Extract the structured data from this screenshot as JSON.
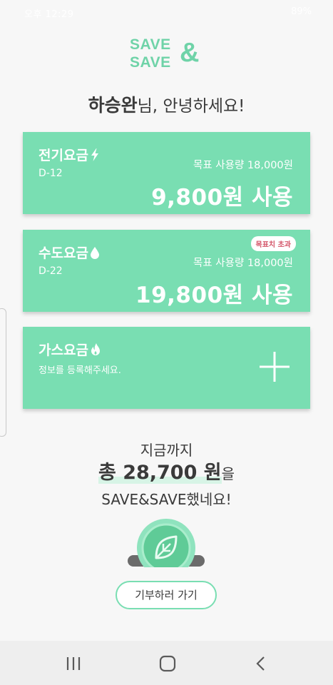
{
  "status_bar": {
    "time": "오후 12:29",
    "battery": "89%"
  },
  "logo": {
    "line1": "SAVE",
    "line2": "SAVE",
    "amp": "&"
  },
  "greeting": {
    "name": "하승완",
    "rest": "님, 안녕하세요!"
  },
  "cards": {
    "electric": {
      "title": "전기요금",
      "icon": "lightning-icon",
      "dday": "D-12",
      "target": "목표 사용량 18,000원",
      "usage": "9,800원 사용"
    },
    "water": {
      "title": "수도요금",
      "icon": "water-drop-icon",
      "dday": "D-22",
      "badge": "목표치 초과",
      "target": "목표 사용량 18,000원",
      "usage": "19,800원 사용"
    },
    "gas": {
      "title": "가스요금",
      "icon": "flame-icon",
      "hint": "정보를 등록해주세요.",
      "add_icon": "plus-icon"
    }
  },
  "savings": {
    "line1": "지금까지",
    "amount": "총 28,700 원",
    "amount_suffix": "을",
    "line3": "SAVE&SAVE했네요!"
  },
  "donate_button": "기부하러 가기",
  "colors": {
    "accent": "#79deb2",
    "badge_text": "#d4566a",
    "text": "#3a3a3a"
  },
  "navbar": {
    "recent": "recent-apps-icon",
    "home": "home-icon",
    "back": "back-icon"
  }
}
